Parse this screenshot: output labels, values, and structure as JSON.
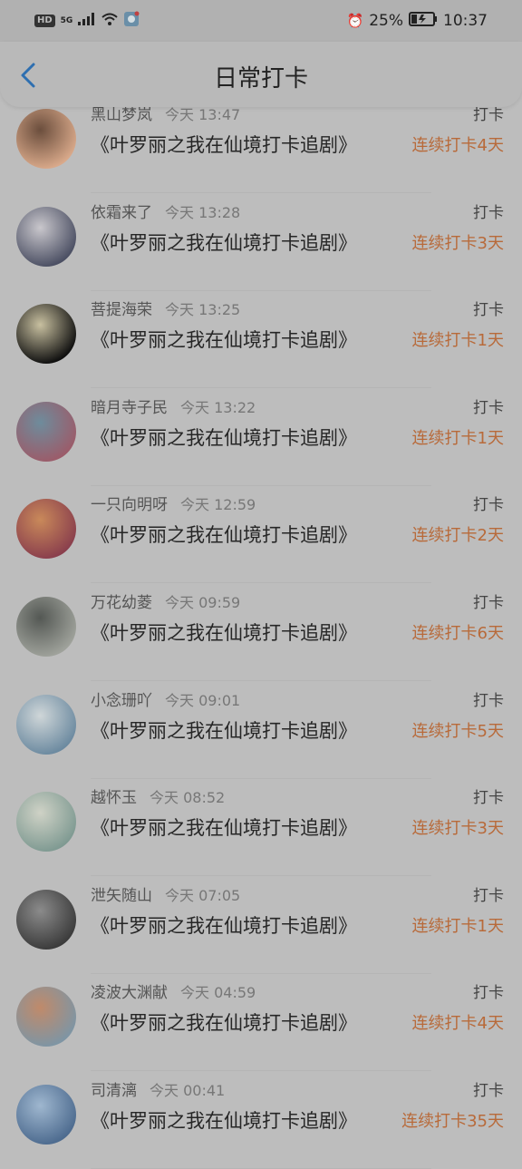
{
  "status_bar": {
    "left_icons": [
      "HD",
      "5G",
      "signal-bars",
      "wifi-icon",
      "app-icon"
    ],
    "battery_percent": "25%",
    "time": "10:37"
  },
  "header": {
    "title": "日常打卡"
  },
  "accent_color": "#b86a3a",
  "rows": [
    {
      "name": "黑山梦岚",
      "time": "今天 13:47",
      "title": "《叶罗丽之我在仙境打卡追剧》",
      "action": "打卡",
      "streak": "连续打卡4天",
      "avatar_colors": [
        "#d9a98a",
        "#6b4e3d"
      ]
    },
    {
      "name": "依霜来了",
      "time": "今天 13:28",
      "title": "《叶罗丽之我在仙境打卡追剧》",
      "action": "打卡",
      "streak": "连续打卡3天",
      "avatar_colors": [
        "#4b4f63",
        "#c9c7cc"
      ]
    },
    {
      "name": "菩提海荣",
      "time": "今天 13:25",
      "title": "《叶罗丽之我在仙境打卡追剧》",
      "action": "打卡",
      "streak": "连续打卡1天",
      "avatar_colors": [
        "#0f0f0f",
        "#c8c0a0"
      ]
    },
    {
      "name": "暗月寺子民",
      "time": "今天 13:22",
      "title": "《叶罗丽之我在仙境打卡追剧》",
      "action": "打卡",
      "streak": "连续打卡1天",
      "avatar_colors": [
        "#9b5c6a",
        "#6e8c9c"
      ]
    },
    {
      "name": "一只向明呀",
      "time": "今天 12:59",
      "title": "《叶罗丽之我在仙境打卡追剧》",
      "action": "打卡",
      "streak": "连续打卡2天",
      "avatar_colors": [
        "#8a3f4d",
        "#c9895a"
      ]
    },
    {
      "name": "万花幼菱",
      "time": "今天 09:59",
      "title": "《叶罗丽之我在仙境打卡追剧》",
      "action": "打卡",
      "streak": "连续打卡6天",
      "avatar_colors": [
        "#9fa29b",
        "#545854"
      ]
    },
    {
      "name": "小念珊吖",
      "time": "今天 09:01",
      "title": "《叶罗丽之我在仙境打卡追剧》",
      "action": "打卡",
      "streak": "连续打卡5天",
      "avatar_colors": [
        "#6c8aa0",
        "#cfd6d8"
      ]
    },
    {
      "name": "越怀玉",
      "time": "今天 08:52",
      "title": "《叶罗丽之我在仙境打卡追剧》",
      "action": "打卡",
      "streak": "连续打卡3天",
      "avatar_colors": [
        "#7f9a92",
        "#cfd2c6"
      ]
    },
    {
      "name": "泄矢随山",
      "time": "今天 07:05",
      "title": "《叶罗丽之我在仙境打卡追剧》",
      "action": "打卡",
      "streak": "连续打卡1天",
      "avatar_colors": [
        "#3b3b3b",
        "#8b8b8b"
      ]
    },
    {
      "name": "凌波大渊献",
      "time": "今天 04:59",
      "title": "《叶罗丽之我在仙境打卡追剧》",
      "action": "打卡",
      "streak": "连续打卡4天",
      "avatar_colors": [
        "#7e95a4",
        "#c08a6a"
      ]
    },
    {
      "name": "司清漓",
      "time": "今天 00:41",
      "title": "《叶罗丽之我在仙境打卡追剧》",
      "action": "打卡",
      "streak": "连续打卡35天",
      "avatar_colors": [
        "#4d6b8f",
        "#9fb7cf"
      ]
    }
  ]
}
